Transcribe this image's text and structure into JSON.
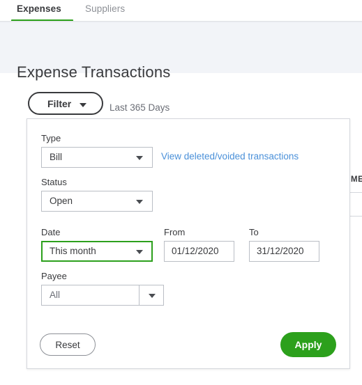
{
  "tabs": [
    {
      "label": "Expenses",
      "active": true
    },
    {
      "label": "Suppliers",
      "active": false
    }
  ],
  "header": {
    "title": "Expense Transactions"
  },
  "toolbar": {
    "filter_label": "Filter",
    "filter_caret_icon": "chevron-down-icon",
    "date_range_text": "Last 365 Days"
  },
  "background_table": {
    "visible_column_header": "ME"
  },
  "filter_panel": {
    "type": {
      "label": "Type",
      "value": "Bill",
      "caret_icon": "chevron-down-icon"
    },
    "view_deleted_link": "View deleted/voided transactions",
    "status": {
      "label": "Status",
      "value": "Open",
      "caret_icon": "chevron-down-icon"
    },
    "date": {
      "label": "Date",
      "value": "This month",
      "caret_icon": "chevron-down-icon",
      "focused": true
    },
    "from": {
      "label": "From",
      "value": "01/12/2020",
      "placeholder": "dd/mm/yyyy"
    },
    "to": {
      "label": "To",
      "value": "31/12/2020",
      "placeholder": "dd/mm/yyyy"
    },
    "payee": {
      "label": "Payee",
      "value": "All",
      "caret_icon": "chevron-down-icon"
    },
    "reset_label": "Reset",
    "apply_label": "Apply"
  },
  "colors": {
    "brand_green": "#2ca01c",
    "link_blue": "#4a90d9",
    "header_band": "#f2f4f8",
    "text_dark": "#393a3d",
    "text_muted": "#6b6e76",
    "border_gray": "#babec5"
  }
}
